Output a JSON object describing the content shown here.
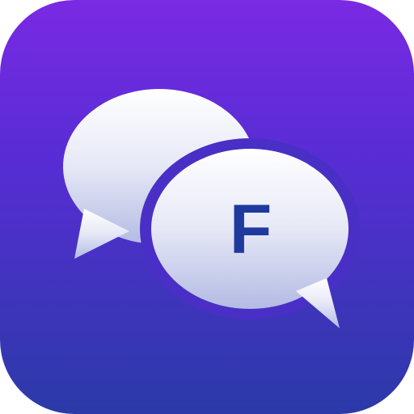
{
  "icon": {
    "letter": "F",
    "letter_color": "#1f3a9e",
    "gradient_top": "#7a2ae3",
    "gradient_bottom": "#2b3aa8",
    "bubble_top": "#ffffff",
    "bubble_bottom": "#b4bbe3"
  }
}
